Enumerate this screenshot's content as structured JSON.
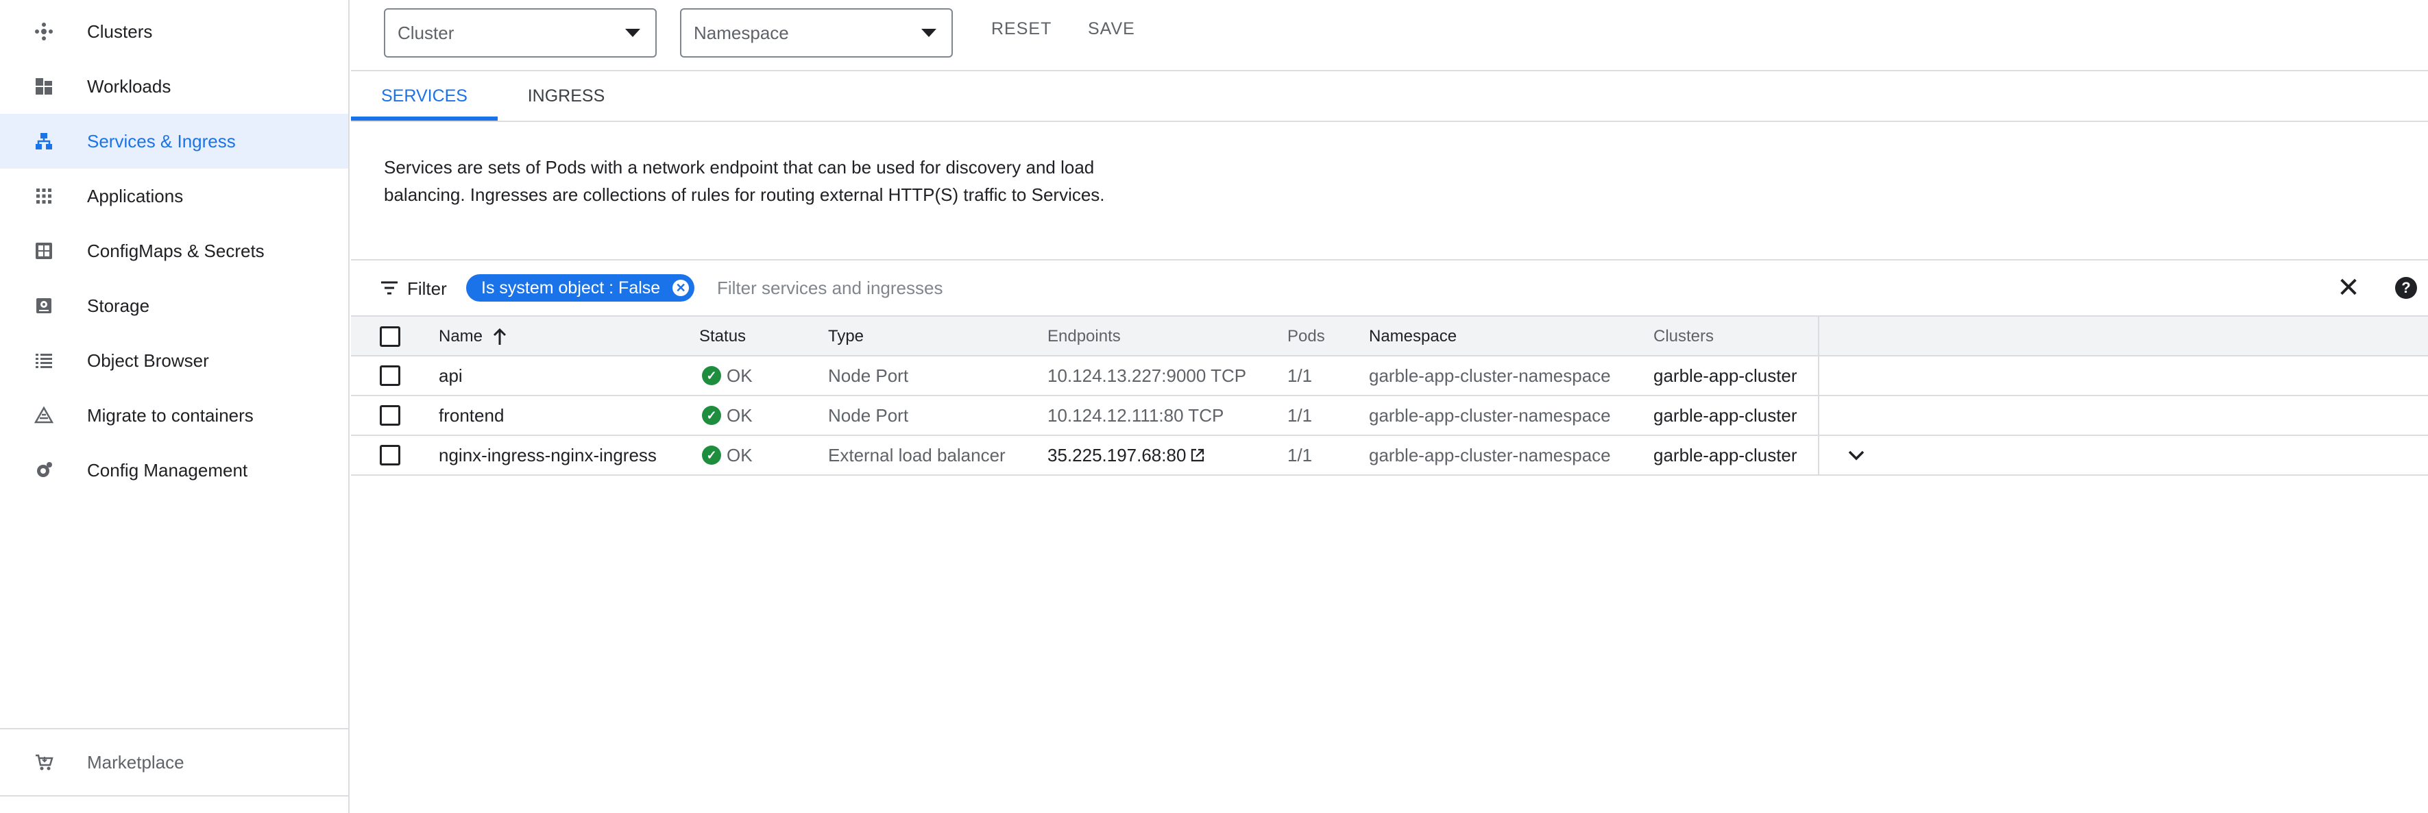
{
  "sidebar": {
    "items": [
      {
        "label": "Clusters",
        "icon": "clusters-icon"
      },
      {
        "label": "Workloads",
        "icon": "workloads-icon"
      },
      {
        "label": "Services & Ingress",
        "icon": "services-icon",
        "active": true
      },
      {
        "label": "Applications",
        "icon": "applications-icon"
      },
      {
        "label": "ConfigMaps & Secrets",
        "icon": "configmaps-icon"
      },
      {
        "label": "Storage",
        "icon": "storage-icon"
      },
      {
        "label": "Object Browser",
        "icon": "object-browser-icon"
      },
      {
        "label": "Migrate to containers",
        "icon": "migrate-icon"
      },
      {
        "label": "Config Management",
        "icon": "config-management-icon"
      }
    ],
    "marketplace": {
      "label": "Marketplace",
      "icon": "cart-icon"
    }
  },
  "toolbar": {
    "cluster_select": "Cluster",
    "namespace_select": "Namespace",
    "reset_label": "RESET",
    "save_label": "SAVE"
  },
  "tabs": [
    {
      "label": "SERVICES",
      "active": true
    },
    {
      "label": "INGRESS",
      "active": false
    }
  ],
  "description": "Services are sets of Pods with a network endpoint that can be used for discovery and load balancing. Ingresses are collections of rules for routing external HTTP(S) traffic to Services.",
  "filter": {
    "label": "Filter",
    "chip_label": "Is system object : False",
    "placeholder": "Filter services and ingresses"
  },
  "table": {
    "columns": {
      "name": "Name",
      "status": "Status",
      "type": "Type",
      "endpoints": "Endpoints",
      "pods": "Pods",
      "namespace": "Namespace",
      "clusters": "Clusters"
    },
    "rows": [
      {
        "name": "api",
        "status": "OK",
        "type": "Node Port",
        "endpoints": "10.124.13.227:9000 TCP",
        "pods": "1/1",
        "namespace": "garble-app-cluster-namespace",
        "cluster": "garble-app-cluster"
      },
      {
        "name": "frontend",
        "status": "OK",
        "type": "Node Port",
        "endpoints": "10.124.12.111:80 TCP",
        "pods": "1/1",
        "namespace": "garble-app-cluster-namespace",
        "cluster": "garble-app-cluster"
      },
      {
        "name": "nginx-ingress-nginx-ingress",
        "status": "OK",
        "type": "External load balancer",
        "endpoints": "35.225.197.68:80",
        "pods": "1/1",
        "namespace": "garble-app-cluster-namespace",
        "cluster": "garble-app-cluster"
      }
    ]
  },
  "colors": {
    "accent": "#1a73e8",
    "ok": "#1e8e3e",
    "active_bg": "#e8f0fe"
  }
}
